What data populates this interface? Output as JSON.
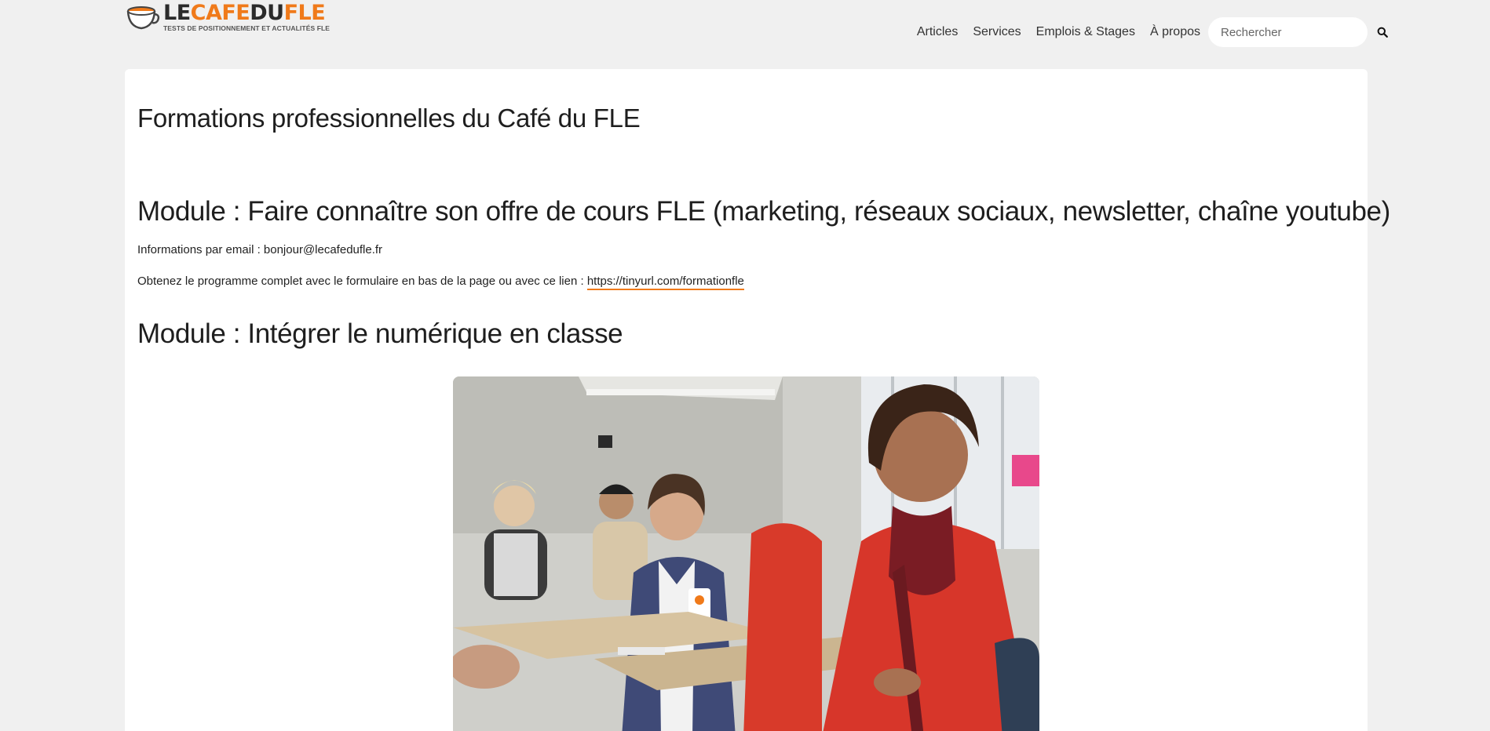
{
  "header": {
    "logo": {
      "part1": "LE",
      "part2": "CAFE",
      "part3": "DU",
      "part4": "FLE",
      "tagline": "TESTS DE POSITIONNEMENT ET ACTUALITÉS FLE"
    },
    "nav": [
      "Articles",
      "Services",
      "Emplois & Stages",
      "À propos"
    ],
    "search": {
      "placeholder": "Rechercher",
      "icon": "search-icon"
    }
  },
  "main": {
    "page_title": "Formations professionnelles du Café du FLE",
    "module1": {
      "title": "Module : Faire connaître son offre de cours FLE (marketing, réseaux sociaux, newsletter, chaîne youtube)",
      "info_text": "Informations par email : bonjour@lecafedufle.fr",
      "program_text": "Obtenez le programme complet avec le formulaire en bas de la page ou avec ce lien : ",
      "program_link": "https://tinyurl.com/formationfle"
    },
    "module2": {
      "title": "Module : Intégrer le numérique en classe"
    }
  },
  "colors": {
    "accent": "#f07a1a",
    "background": "#f0f0f0",
    "card": "#ffffff"
  }
}
